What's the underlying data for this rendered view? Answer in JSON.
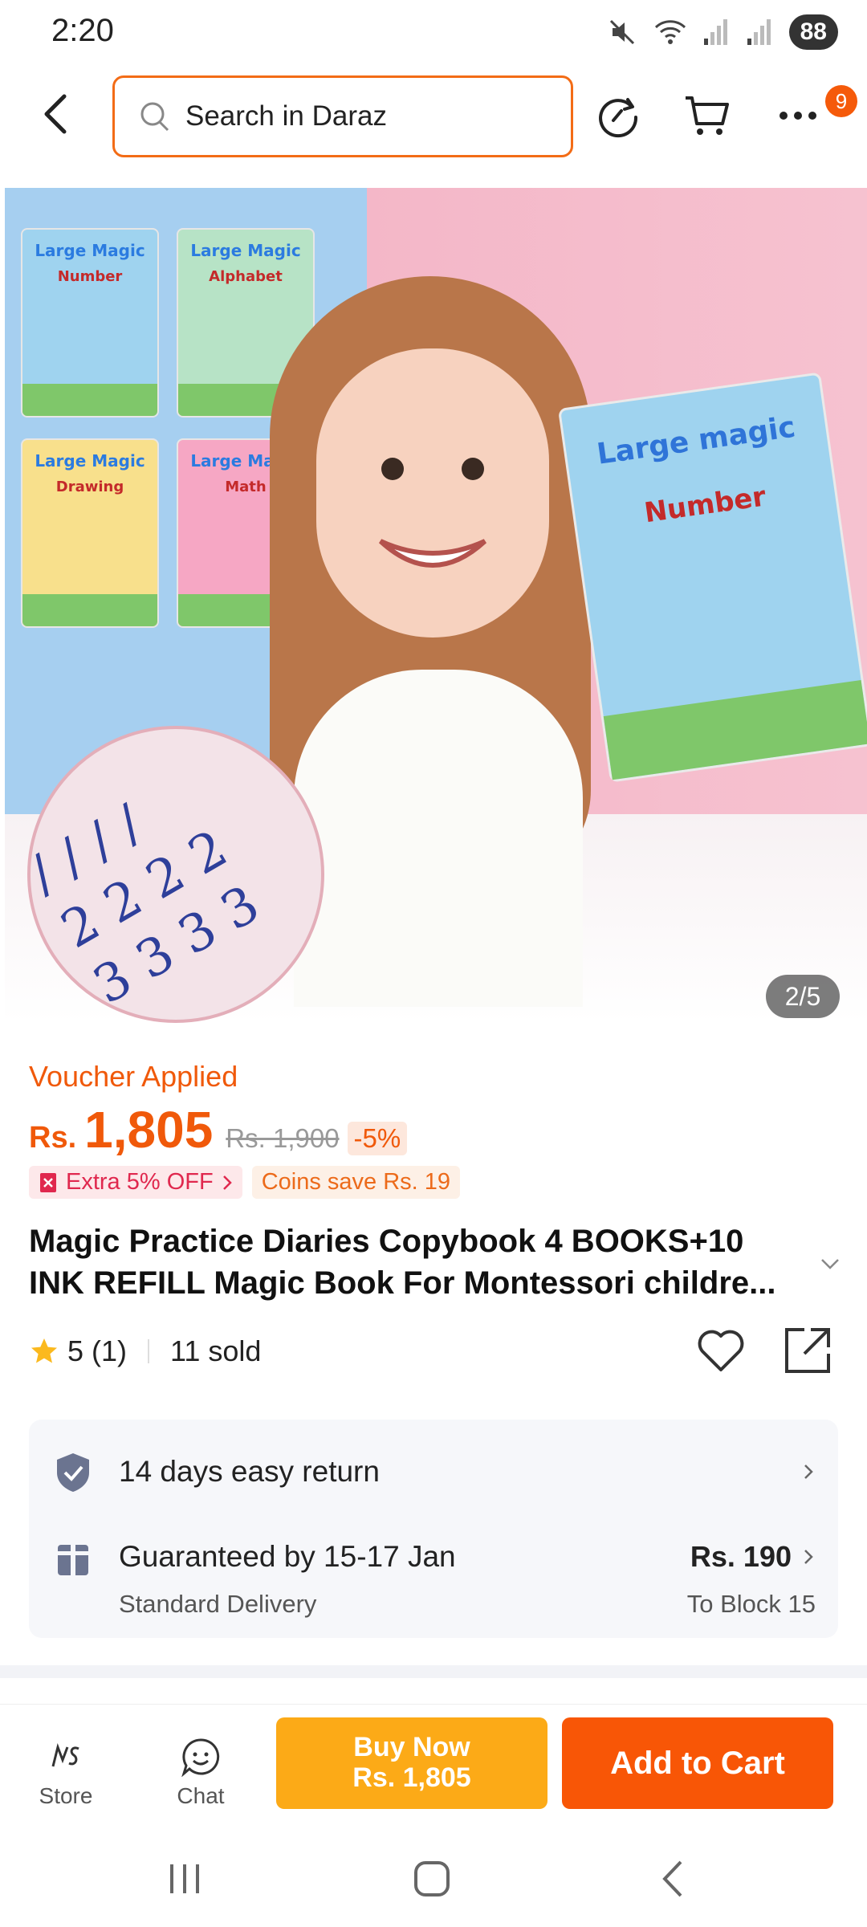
{
  "status_bar": {
    "time": "2:20",
    "battery": "88"
  },
  "header": {
    "search_placeholder": "Search in Daraz",
    "cart_badge": "9"
  },
  "gallery": {
    "counter": "2/5",
    "book_titles": [
      "Large Magic",
      "Large Magic",
      "Large Magic",
      "Large Magic"
    ],
    "book_subjects": [
      "Number",
      "Alphabet",
      "Drawing",
      "Math"
    ],
    "held_book_title": "Large magic",
    "held_book_subject": "Number"
  },
  "product": {
    "voucher_label": "Voucher Applied",
    "currency": "Rs.",
    "price": "1,805",
    "old_price": "Rs. 1,900",
    "discount": "-5%",
    "promo_extra": "Extra 5% OFF",
    "promo_coins": "Coins save Rs. 19",
    "title": "Magic Practice Diaries Copybook 4 BOOKS+10 INK REFILL Magic Book For Montessori childre...",
    "rating": "5",
    "rating_count": "(1)",
    "sold": "11 sold"
  },
  "info": {
    "return_text": "14 days easy return",
    "delivery_text": "Guaranteed by 15-17 Jan",
    "delivery_type": "Standard Delivery",
    "delivery_price": "Rs. 190",
    "delivery_location": "To Block 15"
  },
  "bottom_bar": {
    "store_label": "Store",
    "chat_label": "Chat",
    "buy_now_label": "Buy Now",
    "buy_now_price": "Rs. 1,805",
    "add_cart_label": "Add to Cart"
  },
  "colors": {
    "accent": "#f85606",
    "buy_now": "#fcaa17",
    "price": "#f0590a"
  }
}
